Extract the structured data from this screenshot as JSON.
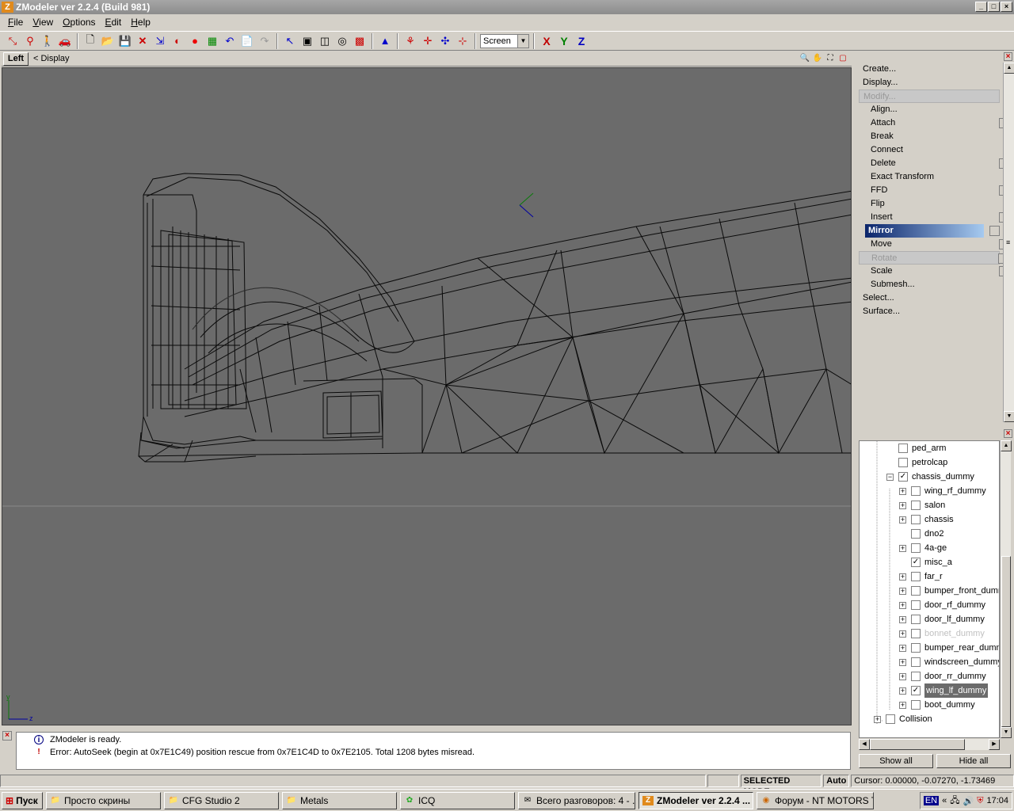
{
  "window": {
    "title": "ZModeler ver 2.2.4 (Build 981)",
    "logo_letter": "Z",
    "min": "_",
    "max": "□",
    "close": "×"
  },
  "menu": [
    {
      "key": "F",
      "rest": "ile"
    },
    {
      "key": "V",
      "rest": "iew"
    },
    {
      "key": "O",
      "rest": "ptions"
    },
    {
      "key": "E",
      "rest": "dit"
    },
    {
      "key": "H",
      "rest": "elp"
    }
  ],
  "toolbar": {
    "coord_mode": "Screen",
    "axis_x": "X",
    "axis_y": "Y",
    "axis_z": "Z",
    "colors": {
      "x": "#c00000",
      "y": "#008000",
      "z": "#0000c0"
    }
  },
  "viewport": {
    "view_name": "Left",
    "display_label": "< Display",
    "axis_label_y": "y",
    "axis_label_z": "z"
  },
  "commands": [
    {
      "label": "Create...",
      "level": 0,
      "state": "normal",
      "chk": false
    },
    {
      "label": "Display...",
      "level": 0,
      "state": "normal",
      "chk": false
    },
    {
      "label": "Modify...",
      "level": 0,
      "state": "disabled",
      "chk": false
    },
    {
      "label": "Align...",
      "level": 1,
      "state": "normal",
      "chk": false
    },
    {
      "label": "Attach",
      "level": 1,
      "state": "normal",
      "chk": true
    },
    {
      "label": "Break",
      "level": 1,
      "state": "normal",
      "chk": false
    },
    {
      "label": "Connect",
      "level": 1,
      "state": "normal",
      "chk": false
    },
    {
      "label": "Delete",
      "level": 1,
      "state": "normal",
      "chk": true
    },
    {
      "label": "Exact Transform",
      "level": 1,
      "state": "normal",
      "chk": false
    },
    {
      "label": "FFD",
      "level": 1,
      "state": "normal",
      "chk": true
    },
    {
      "label": "Flip",
      "level": 1,
      "state": "normal",
      "chk": false
    },
    {
      "label": "Insert",
      "level": 1,
      "state": "normal",
      "chk": true
    },
    {
      "label": "Mirror",
      "level": 1,
      "state": "active",
      "chk": true
    },
    {
      "label": "Move",
      "level": 1,
      "state": "normal",
      "chk": true
    },
    {
      "label": "Rotate",
      "level": 1,
      "state": "disabled",
      "chk": true
    },
    {
      "label": "Scale",
      "level": 1,
      "state": "normal",
      "chk": true
    },
    {
      "label": "Submesh...",
      "level": 1,
      "state": "normal",
      "chk": false
    },
    {
      "label": "Select...",
      "level": 0,
      "state": "normal",
      "chk": false
    },
    {
      "label": "Surface...",
      "level": 0,
      "state": "normal",
      "chk": false
    }
  ],
  "tree": [
    {
      "label": "ped_arm",
      "indent": 1,
      "exp": "",
      "checked": false,
      "state": ""
    },
    {
      "label": "petrolcap",
      "indent": 1,
      "exp": "",
      "checked": false,
      "state": ""
    },
    {
      "label": "chassis_dummy",
      "indent": 1,
      "exp": "−",
      "checked": true,
      "state": ""
    },
    {
      "label": "wing_rf_dummy",
      "indent": 2,
      "exp": "+",
      "checked": false,
      "state": ""
    },
    {
      "label": "salon",
      "indent": 2,
      "exp": "+",
      "checked": false,
      "state": ""
    },
    {
      "label": "chassis",
      "indent": 2,
      "exp": "+",
      "checked": false,
      "state": ""
    },
    {
      "label": "dno2",
      "indent": 2,
      "exp": "",
      "checked": false,
      "state": ""
    },
    {
      "label": "4a-ge",
      "indent": 2,
      "exp": "+",
      "checked": false,
      "state": ""
    },
    {
      "label": "misc_a",
      "indent": 2,
      "exp": "",
      "checked": true,
      "state": ""
    },
    {
      "label": "far_r",
      "indent": 2,
      "exp": "+",
      "checked": false,
      "state": ""
    },
    {
      "label": "bumper_front_dumm",
      "indent": 2,
      "exp": "+",
      "checked": false,
      "state": ""
    },
    {
      "label": "door_rf_dummy",
      "indent": 2,
      "exp": "+",
      "checked": false,
      "state": ""
    },
    {
      "label": "door_lf_dummy",
      "indent": 2,
      "exp": "+",
      "checked": false,
      "state": ""
    },
    {
      "label": "bonnet_dummy",
      "indent": 2,
      "exp": "+",
      "checked": false,
      "state": "faded"
    },
    {
      "label": "bumper_rear_dumm",
      "indent": 2,
      "exp": "+",
      "checked": false,
      "state": ""
    },
    {
      "label": "windscreen_dummy",
      "indent": 2,
      "exp": "+",
      "checked": false,
      "state": ""
    },
    {
      "label": "door_rr_dummy",
      "indent": 2,
      "exp": "+",
      "checked": false,
      "state": ""
    },
    {
      "label": "wing_lf_dummy",
      "indent": 2,
      "exp": "+",
      "checked": true,
      "state": "sel"
    },
    {
      "label": "boot_dummy",
      "indent": 2,
      "exp": "+",
      "checked": false,
      "state": ""
    },
    {
      "label": "Collision",
      "indent": 0,
      "exp": "+",
      "checked": false,
      "state": ""
    }
  ],
  "tree_buttons": {
    "show_all": "Show all",
    "hide_all": "Hide all"
  },
  "log": [
    {
      "icon": "i",
      "text": "ZModeler is ready.",
      "color": "#000080"
    },
    {
      "icon": "!",
      "text": "Error: AutoSeek (begin at 0x7E1C49) position rescue  from 0x7E1C4D to 0x7E2105. Total 1208 bytes misread.",
      "color": "#c00000"
    }
  ],
  "status": {
    "mode": "SELECTED MODE",
    "auto": "Auto",
    "cursor": "Cursor: 0.00000, -0.07270, -1.73469"
  },
  "taskbar": {
    "start": "Пуск",
    "tasks": [
      {
        "label": "Просто скрины",
        "icon": "folder-icon",
        "width": 145,
        "active": false
      },
      {
        "label": "CFG Studio 2",
        "icon": "folder-icon",
        "width": 145,
        "active": false
      },
      {
        "label": "Metals",
        "icon": "folder-icon",
        "width": 145,
        "active": false
      },
      {
        "label": "ICQ",
        "icon": "icq-icon",
        "width": 145,
        "active": false
      },
      {
        "label": "Всего разговоров: 4 - ...",
        "icon": "chat-icon",
        "width": 148,
        "active": false
      },
      {
        "label": "ZModeler ver 2.2.4 ...",
        "icon": "zmodeler-icon",
        "width": 145,
        "active": true
      },
      {
        "label": "Форум - NT MOTORS T...",
        "icon": "browser-icon",
        "width": 148,
        "active": false
      }
    ],
    "lang": "EN",
    "clock": "17:04"
  }
}
